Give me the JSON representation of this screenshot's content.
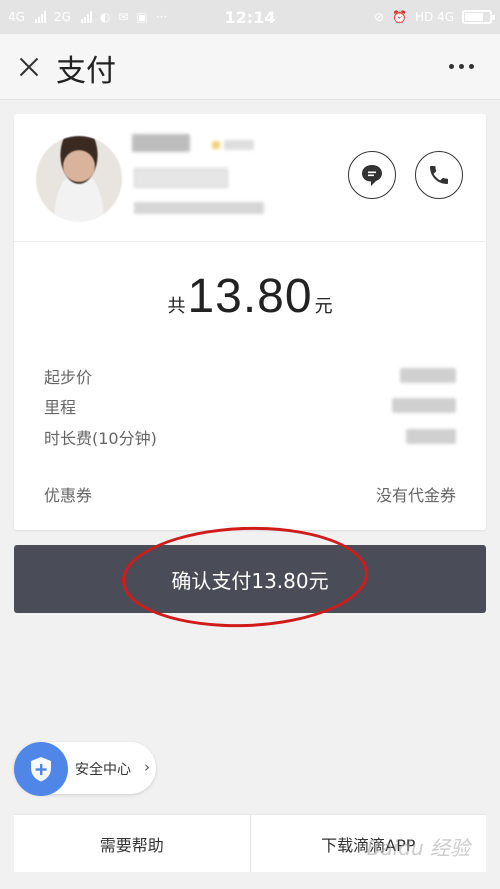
{
  "status_bar": {
    "network_1": "4G",
    "network_2": "2G",
    "time": "12:14",
    "network_right": "HD 4G"
  },
  "header": {
    "title": "支付",
    "close_icon": "close-icon",
    "more_icon": "more-icon"
  },
  "driver": {
    "message_icon": "message-icon",
    "phone_icon": "phone-icon"
  },
  "fare": {
    "prefix": "共",
    "amount": "13.80",
    "unit": "元",
    "items": [
      {
        "label": "起步价"
      },
      {
        "label": "里程"
      },
      {
        "label": "时长费(10分钟)"
      }
    ],
    "coupon_label": "优惠券",
    "coupon_value": "没有代金券"
  },
  "pay_button": {
    "label": "确认支付13.80元"
  },
  "safety_center": {
    "label": "安全中心",
    "chevron": "›",
    "icon": "shield-plus-icon"
  },
  "bottom_bar": {
    "help_label": "需要帮助",
    "download_label": "下载滴滴APP"
  },
  "watermark": {
    "text": "Baidu 经验"
  },
  "colors": {
    "pay_button": "#4a4c58",
    "annotation": "#d01b1b",
    "safety_badge": "#4f86e8",
    "star": "#f3d27a"
  }
}
